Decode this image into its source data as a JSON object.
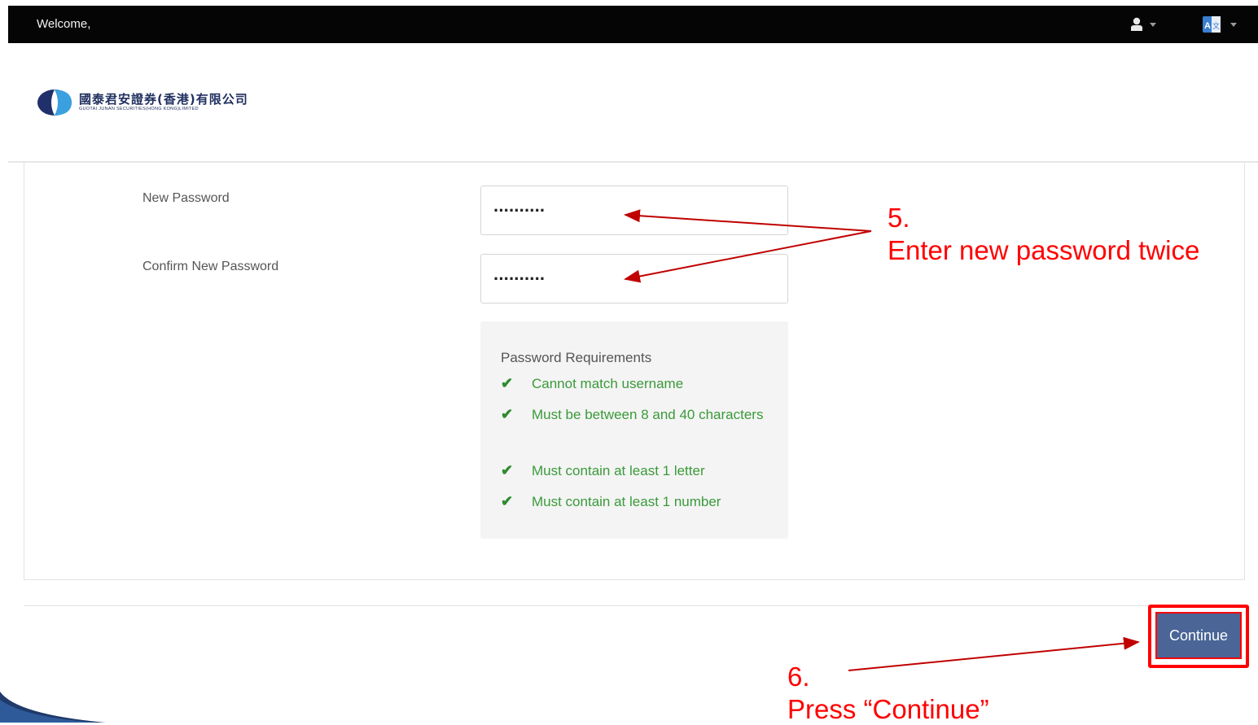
{
  "topbar": {
    "welcome": "Welcome,"
  },
  "logo": {
    "chinese_name": "國泰君安證券(香港)有限公司",
    "english_name": "GUOTAI JUNAN SECURITIES(HONG KONG)LIMITED"
  },
  "form": {
    "new_password_label": "New Password",
    "new_password_value": "··········",
    "confirm_password_label": "Confirm New Password",
    "confirm_password_value": "··········"
  },
  "requirements": {
    "title": "Password Requirements",
    "items": [
      "Cannot match username",
      "Must be between 8 and 40 characters",
      "Must contain at least 1 letter",
      "Must contain at least 1 number"
    ]
  },
  "buttons": {
    "continue": "Continue"
  },
  "annotations": {
    "step5_number": "5.",
    "step5_text": "Enter new password twice",
    "step6_number": "6.",
    "step6_text": "Press “Continue”"
  },
  "colors": {
    "topbar": "#050505",
    "button": "#4a6596",
    "annotation": "#ff0000",
    "check": "#3a9a3a"
  }
}
